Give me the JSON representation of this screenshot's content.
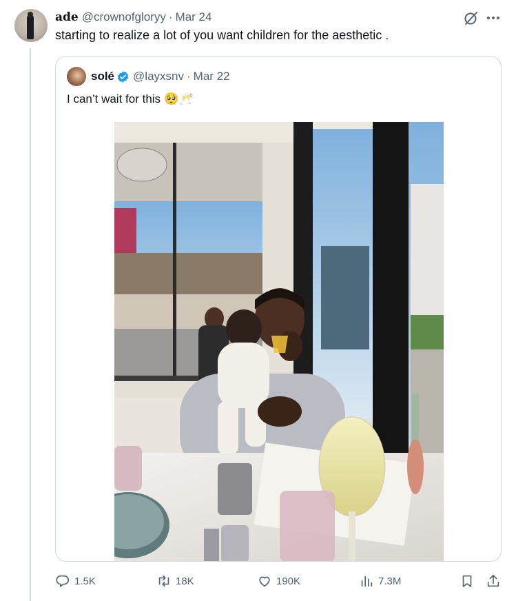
{
  "tweet": {
    "author_name": "ade",
    "author_handle": "@crownofgloryy",
    "separator": "·",
    "date": "Mar 24",
    "text": "starting to realize a lot of you want children for the aesthetic ."
  },
  "quoted": {
    "author_name": "solé",
    "author_handle": "@layxsnv",
    "separator": "·",
    "date": "Mar 22",
    "text": "I can’t wait for this",
    "emojis": "🥺🥂",
    "verified": true
  },
  "actions": {
    "replies": "1.5K",
    "retweets": "18K",
    "likes": "190K",
    "views": "7.3M"
  },
  "icons": [
    "grok-icon",
    "more-icon",
    "verified-badge-icon",
    "reply-icon",
    "retweet-icon",
    "like-icon",
    "views-icon",
    "bookmark-icon",
    "share-icon"
  ],
  "colors": {
    "text_primary": "#0f1419",
    "text_secondary": "#536471",
    "border": "#cfd9de",
    "verified": "#1d9bf0"
  }
}
